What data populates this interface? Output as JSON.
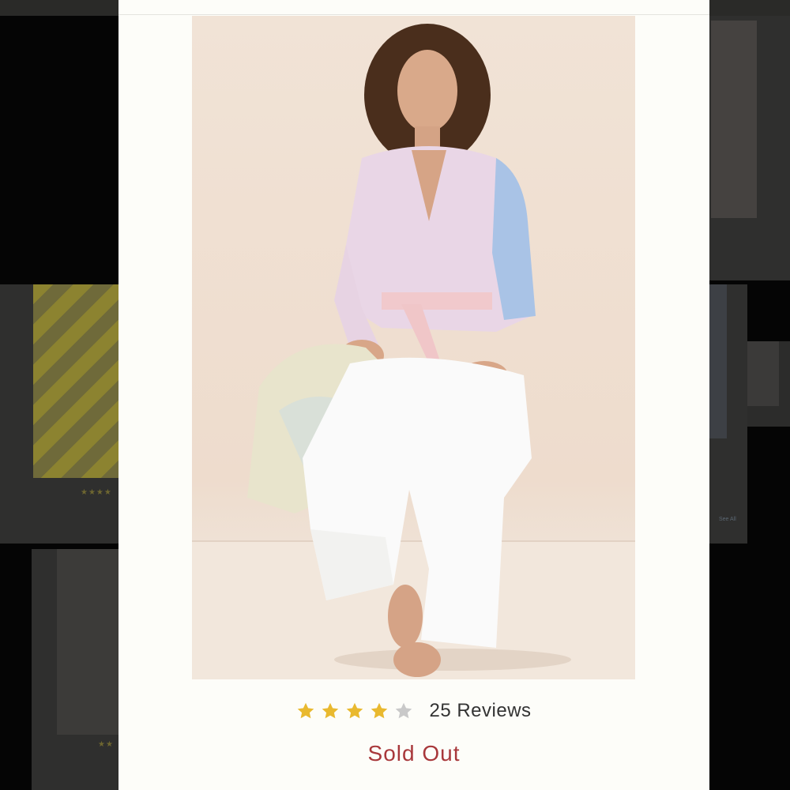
{
  "product": {
    "image_alt": "Model wearing pastel tie-dye button-down shirt and white flare jeans",
    "rating": 4,
    "rating_max": 5,
    "reviews_label": "25 Reviews",
    "status": "Sold Out"
  },
  "colors": {
    "star_filled": "#e9b92f",
    "star_empty": "#c9c9c9",
    "sold_out": "#a8383b",
    "modal_bg": "#fdfdf9"
  },
  "background": {
    "see_all": "See All"
  }
}
